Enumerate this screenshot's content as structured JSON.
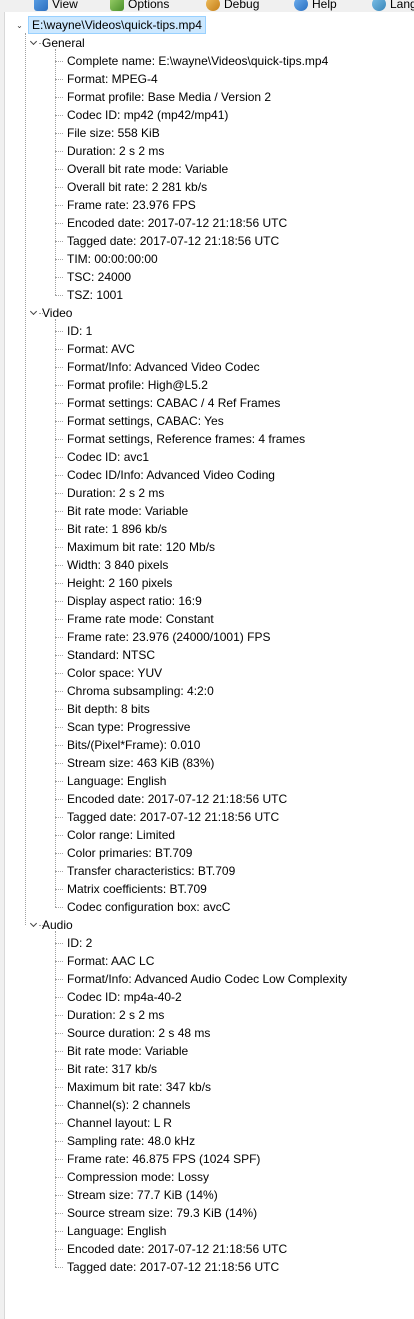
{
  "menu": {
    "view": "View",
    "options": "Options",
    "debug": "Debug",
    "help": "Help",
    "language": "Lang"
  },
  "root": {
    "label": "E:\\wayne\\Videos\\quick-tips.mp4"
  },
  "sections": [
    {
      "name": "General",
      "items": [
        "Complete name: E:\\wayne\\Videos\\quick-tips.mp4",
        "Format: MPEG-4",
        "Format profile: Base Media / Version 2",
        "Codec ID: mp42 (mp42/mp41)",
        "File size: 558 KiB",
        "Duration: 2 s 2 ms",
        "Overall bit rate mode: Variable",
        "Overall bit rate: 2 281 kb/s",
        "Frame rate: 23.976 FPS",
        "Encoded date: 2017-07-12 21:18:56 UTC",
        "Tagged date: 2017-07-12 21:18:56 UTC",
        "TIM: 00:00:00:00",
        "TSC: 24000",
        "TSZ: 1001"
      ]
    },
    {
      "name": "Video",
      "items": [
        "ID: 1",
        "Format: AVC",
        "Format/Info: Advanced Video Codec",
        "Format profile: High@L5.2",
        "Format settings: CABAC / 4 Ref Frames",
        "Format settings, CABAC: Yes",
        "Format settings, Reference frames: 4 frames",
        "Codec ID: avc1",
        "Codec ID/Info: Advanced Video Coding",
        "Duration: 2 s 2 ms",
        "Bit rate mode: Variable",
        "Bit rate: 1 896 kb/s",
        "Maximum bit rate: 120 Mb/s",
        "Width: 3 840 pixels",
        "Height: 2 160 pixels",
        "Display aspect ratio: 16:9",
        "Frame rate mode: Constant",
        "Frame rate: 23.976 (24000/1001) FPS",
        "Standard: NTSC",
        "Color space: YUV",
        "Chroma subsampling: 4:2:0",
        "Bit depth: 8 bits",
        "Scan type: Progressive",
        "Bits/(Pixel*Frame): 0.010",
        "Stream size: 463 KiB (83%)",
        "Language: English",
        "Encoded date: 2017-07-12 21:18:56 UTC",
        "Tagged date: 2017-07-12 21:18:56 UTC",
        "Color range: Limited",
        "Color primaries: BT.709",
        "Transfer characteristics: BT.709",
        "Matrix coefficients: BT.709",
        "Codec configuration box: avcC"
      ]
    },
    {
      "name": "Audio",
      "items": [
        "ID: 2",
        "Format: AAC LC",
        "Format/Info: Advanced Audio Codec Low Complexity",
        "Codec ID: mp4a-40-2",
        "Duration: 2 s 2 ms",
        "Source duration: 2 s 48 ms",
        "Bit rate mode: Variable",
        "Bit rate: 317 kb/s",
        "Maximum bit rate: 347 kb/s",
        "Channel(s): 2 channels",
        "Channel layout: L R",
        "Sampling rate: 48.0 kHz",
        "Frame rate: 46.875 FPS (1024 SPF)",
        "Compression mode: Lossy",
        "Stream size: 77.7 KiB (14%)",
        "Source stream size: 79.3 KiB (14%)",
        "Language: English",
        "Encoded date: 2017-07-12 21:18:56 UTC",
        "Tagged date: 2017-07-12 21:18:56 UTC"
      ]
    }
  ]
}
